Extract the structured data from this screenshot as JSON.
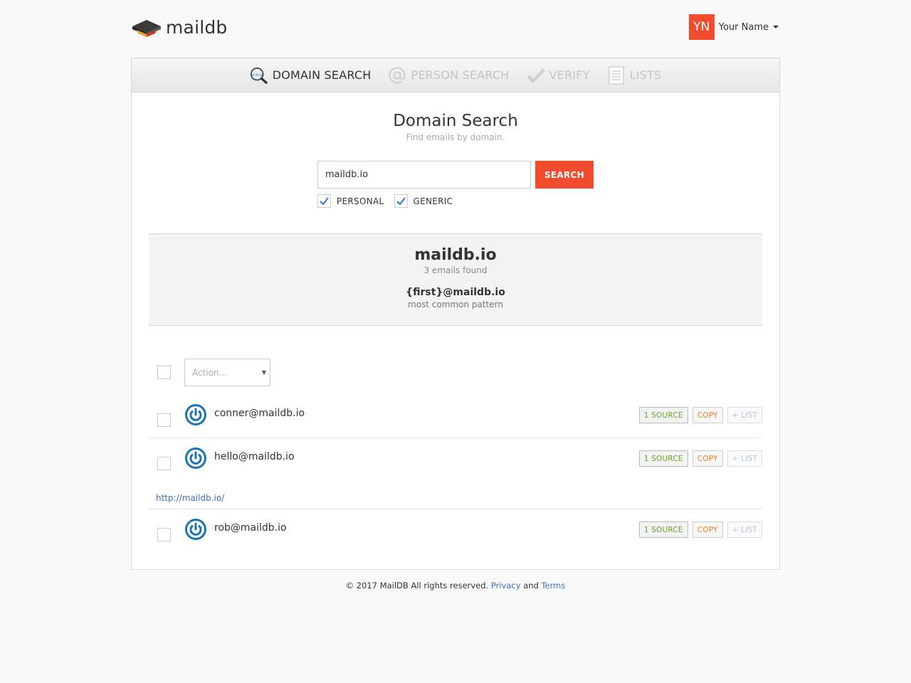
{
  "header": {
    "logo_text": "maildb",
    "user_initials": "YN",
    "user_name": "Your Name",
    "accent_color": "#f24c2e"
  },
  "tabs": [
    {
      "label": "DOMAIN SEARCH",
      "icon": "www-magnifier-icon",
      "active": true
    },
    {
      "label": "PERSON SEARCH",
      "icon": "at-sign-icon",
      "active": false
    },
    {
      "label": "VERIFY",
      "icon": "checkmark-icon",
      "active": false
    },
    {
      "label": "LISTS",
      "icon": "list-doc-icon",
      "active": false
    }
  ],
  "search": {
    "title": "Domain Search",
    "subtitle": "Find emails by domain.",
    "query": "maildb.io",
    "button_label": "SEARCH",
    "filters": [
      {
        "label": "PERSONAL",
        "checked": true
      },
      {
        "label": "GENERIC",
        "checked": true
      }
    ]
  },
  "summary": {
    "domain": "maildb.io",
    "count_text": "3 emails found",
    "pattern": "{first}@maildb.io",
    "pattern_label": "most common pattern"
  },
  "bulk": {
    "action_placeholder": "Action..."
  },
  "emails": [
    {
      "address": "conner@maildb.io",
      "source_label": "1 SOURCE",
      "copy_label": "COPY",
      "list_label": "+ LIST",
      "source_url": ""
    },
    {
      "address": "hello@maildb.io",
      "source_label": "1 SOURCE",
      "copy_label": "COPY",
      "list_label": "+ LIST",
      "source_url": "http://maildb.io/"
    },
    {
      "address": "rob@maildb.io",
      "source_label": "1 SOURCE",
      "copy_label": "COPY",
      "list_label": "+ LIST",
      "source_url": ""
    }
  ],
  "footer": {
    "copyright": "© 2017 MailDB All rights reserved.",
    "privacy_label": "Privacy",
    "and_text": "and",
    "terms_label": "Terms"
  }
}
